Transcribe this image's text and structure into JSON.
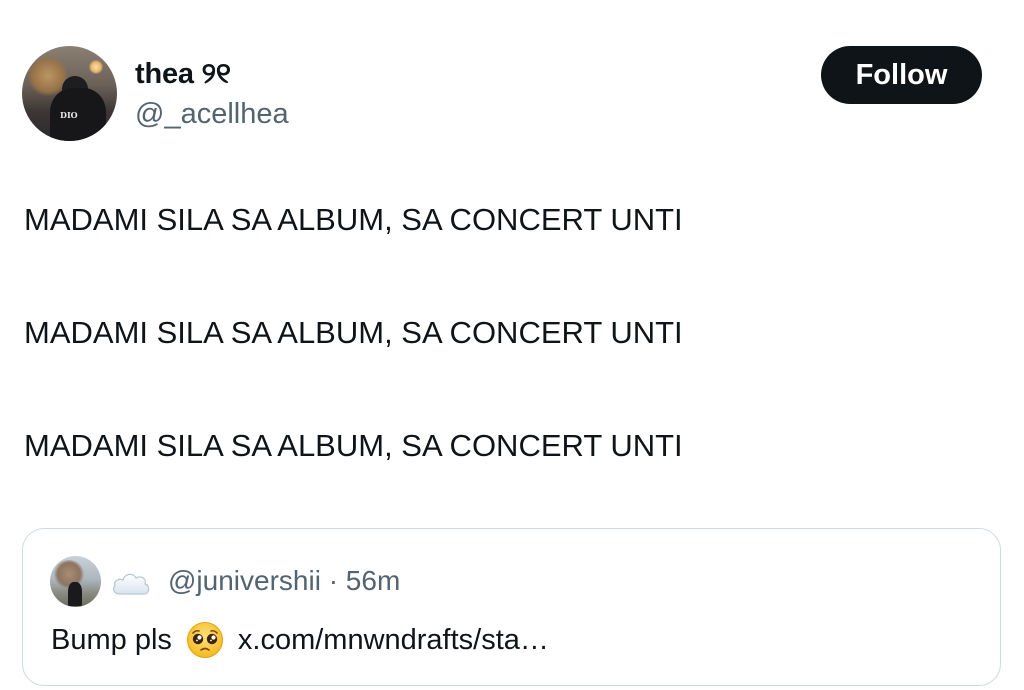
{
  "author": {
    "display_name": "thea ୨୧",
    "handle": "@_acellhea",
    "avatar_brand_text": "DIO"
  },
  "follow_button": {
    "label": "Follow"
  },
  "tweet": {
    "lines": [
      "MADAMI SILA SA ALBUM, SA CONCERT UNTI",
      "MADAMI SILA SA ALBUM, SA CONCERT UNTI",
      "MADAMI SILA SA ALBUM, SA CONCERT UNTI"
    ]
  },
  "quoted_tweet": {
    "handle_time": "@junivershii · 56m",
    "text_before": "Bump pls",
    "text_after": "x.com/mnwndrafts/sta…",
    "icons": [
      "cloud-icon",
      "pleading-face-icon"
    ]
  },
  "colors": {
    "text_primary": "#0f1419",
    "text_secondary": "#536471",
    "button_bg": "#0f1419",
    "border": "#cfd9de"
  }
}
